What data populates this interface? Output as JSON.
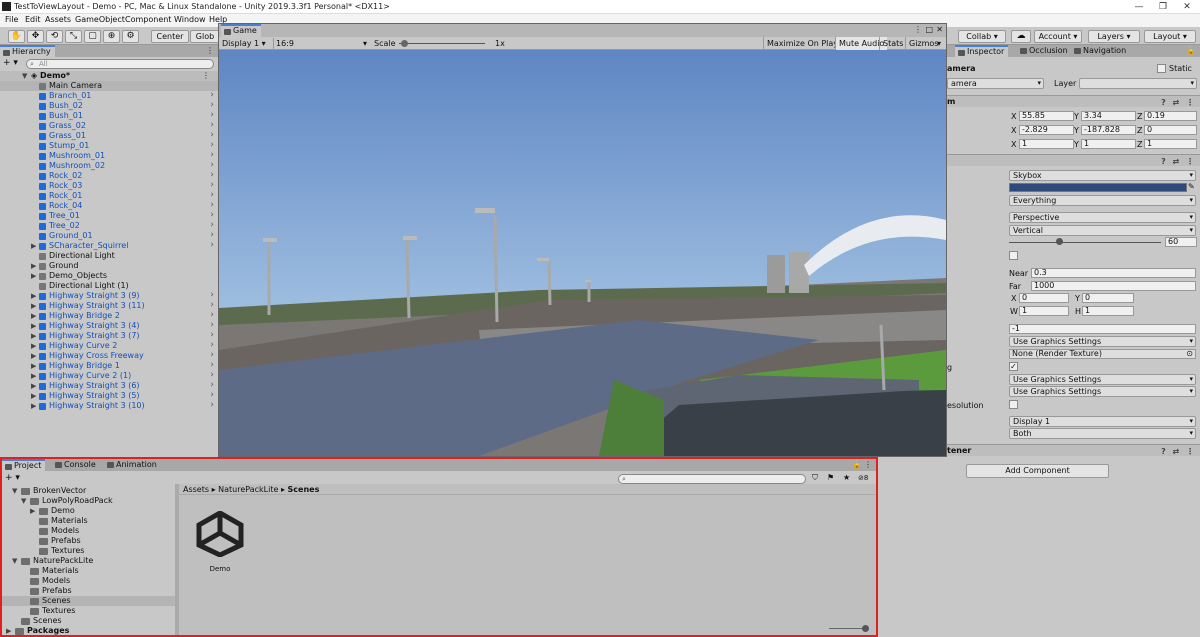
{
  "window": {
    "title": "TestToViewLayout - Demo - PC, Mac & Linux Standalone - Unity 2019.3.3f1 Personal* <DX11>",
    "minimize": "—",
    "restore": "❐",
    "close": "✕"
  },
  "menu": [
    "File",
    "Edit",
    "Assets",
    "GameObject",
    "Component",
    "Window",
    "Help"
  ],
  "toolbar": {
    "pivot": "Center",
    "space": "Glob",
    "collab": "Collab",
    "account": "Account",
    "layers": "Layers",
    "layout": "Layout"
  },
  "hierarchy": {
    "tab": "Hierarchy",
    "search_placeholder": "All",
    "scene": "Demo*",
    "items": [
      {
        "label": "Main Camera",
        "kind": "object",
        "selected": true
      },
      {
        "label": "Branch_01",
        "kind": "prefab"
      },
      {
        "label": "Bush_02",
        "kind": "prefab"
      },
      {
        "label": "Bush_01",
        "kind": "prefab"
      },
      {
        "label": "Grass_02",
        "kind": "prefab"
      },
      {
        "label": "Grass_01",
        "kind": "prefab"
      },
      {
        "label": "Stump_01",
        "kind": "prefab"
      },
      {
        "label": "Mushroom_01",
        "kind": "prefab"
      },
      {
        "label": "Mushroom_02",
        "kind": "prefab"
      },
      {
        "label": "Rock_02",
        "kind": "prefab"
      },
      {
        "label": "Rock_03",
        "kind": "prefab"
      },
      {
        "label": "Rock_01",
        "kind": "prefab"
      },
      {
        "label": "Rock_04",
        "kind": "prefab"
      },
      {
        "label": "Tree_01",
        "kind": "prefab"
      },
      {
        "label": "Tree_02",
        "kind": "prefab"
      },
      {
        "label": "Ground_01",
        "kind": "prefab"
      },
      {
        "label": "SCharacter_Squirrel",
        "kind": "prefab",
        "expandable": true
      },
      {
        "label": "Directional Light",
        "kind": "object"
      },
      {
        "label": "Ground",
        "kind": "object",
        "expandable": true
      },
      {
        "label": "Demo_Objects",
        "kind": "object",
        "expandable": true
      },
      {
        "label": "Directional Light (1)",
        "kind": "object"
      },
      {
        "label": "Highway Straight 3 (9)",
        "kind": "prefab",
        "expandable": true
      },
      {
        "label": "Highway Straight 3 (11)",
        "kind": "prefab",
        "expandable": true
      },
      {
        "label": "Highway Bridge 2",
        "kind": "prefab",
        "expandable": true
      },
      {
        "label": "Highway Straight 3 (4)",
        "kind": "prefab",
        "expandable": true
      },
      {
        "label": "Highway Straight 3 (7)",
        "kind": "prefab",
        "expandable": true
      },
      {
        "label": "Highway Curve 2",
        "kind": "prefab",
        "expandable": true
      },
      {
        "label": "Highway Cross Freeway",
        "kind": "prefab",
        "expandable": true
      },
      {
        "label": "Highway Bridge 1",
        "kind": "prefab",
        "expandable": true
      },
      {
        "label": "Highway Curve 2 (1)",
        "kind": "prefab",
        "expandable": true
      },
      {
        "label": "Highway Straight 3 (6)",
        "kind": "prefab",
        "expandable": true
      },
      {
        "label": "Highway Straight 3 (5)",
        "kind": "prefab",
        "expandable": true
      },
      {
        "label": "Highway Straight 3 (10)",
        "kind": "prefab",
        "expandable": true
      }
    ]
  },
  "game": {
    "tab": "Game",
    "display": "Display 1",
    "aspect": "16:9",
    "scale_label": "Scale",
    "scale_value": "1x",
    "scale_level": 0.02,
    "maximize": "Maximize On Play",
    "mute": "Mute Audio",
    "stats": "Stats",
    "gizmos": "Gizmos"
  },
  "inspector": {
    "tabs": [
      "Inspector",
      "Occlusion",
      "Navigation"
    ],
    "object_name": "amera",
    "static_label": "Static",
    "tag_value": "amera",
    "layer_label": "Layer",
    "transform_header": "m",
    "position": {
      "x": "55.85",
      "y": "3.34",
      "z": "0.19"
    },
    "rotation": {
      "x": "-2.829",
      "y": "-187.828",
      "z": "0"
    },
    "scale": {
      "x": "1",
      "y": "1",
      "z": "1"
    },
    "axis": {
      "x": "X",
      "y": "Y",
      "z": "Z",
      "w": "W",
      "h": "H"
    },
    "camera": {
      "clear_flags": "Skybox",
      "background_color": "#2d4a7a",
      "culling_mask": "Everything",
      "projection": "Perspective",
      "fov_axis": "Vertical",
      "fov": "60",
      "fov_level": 0.33,
      "near_label": "Near",
      "near": "0.3",
      "far_label": "Far",
      "far": "1000",
      "viewport": {
        "x": "0",
        "y": "0",
        "w": "1",
        "h": "1"
      },
      "depth": "-1",
      "rendering_path": "Use Graphics Settings",
      "target_texture": "None (Render Texture)",
      "occlusion_culling": true,
      "hdr": "Use Graphics Settings",
      "msaa": "Use Graphics Settings",
      "dynamic_resolution_label": "esolution",
      "target_display": "Display 1",
      "target_eye": "Both",
      "partial_label": "g"
    },
    "listener_header": "tener",
    "add_component": "Add Component"
  },
  "project": {
    "tabs": [
      "Project",
      "Console",
      "Animation"
    ],
    "hidden_count": "8",
    "tree": [
      {
        "label": "BrokenVector",
        "depth": 0,
        "open": true
      },
      {
        "label": "LowPolyRoadPack",
        "depth": 1,
        "open": true
      },
      {
        "label": "Demo",
        "depth": 2,
        "expandable": true
      },
      {
        "label": "Materials",
        "depth": 2
      },
      {
        "label": "Models",
        "depth": 2
      },
      {
        "label": "Prefabs",
        "depth": 2
      },
      {
        "label": "Textures",
        "depth": 2
      },
      {
        "label": "NaturePackLite",
        "depth": 0,
        "open": true
      },
      {
        "label": "Materials",
        "depth": 1
      },
      {
        "label": "Models",
        "depth": 1
      },
      {
        "label": "Prefabs",
        "depth": 1
      },
      {
        "label": "Scenes",
        "depth": 1,
        "selected": true
      },
      {
        "label": "Textures",
        "depth": 1
      },
      {
        "label": "Scenes",
        "depth": 0
      },
      {
        "label": "Packages",
        "depth": -1,
        "bold": true,
        "expandable": true
      }
    ],
    "breadcrumb": [
      "Assets",
      "NaturePackLite",
      "Scenes"
    ],
    "assets": [
      {
        "name": "Demo",
        "icon": "unity-scene-icon"
      }
    ],
    "zoom_level": 0.95
  }
}
